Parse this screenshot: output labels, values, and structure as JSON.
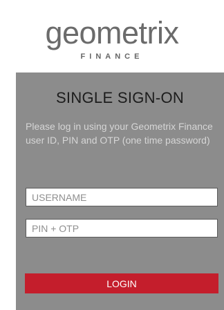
{
  "logo": {
    "wordmark": "geometrix",
    "subtitle": "FINANCE"
  },
  "login": {
    "title": "SINGLE SIGN-ON",
    "description": "Please log in using your Geometrix Finance user ID, PIN and OTP (one time password)",
    "username_placeholder": "USERNAME",
    "username_value": "",
    "pin_placeholder": "PIN + OTP",
    "pin_value": "",
    "login_label": "LOGIN"
  },
  "colors": {
    "panel_background": "#8c8c8c",
    "login_button": "#c41e2c",
    "logo_text": "#6b6b6b"
  }
}
